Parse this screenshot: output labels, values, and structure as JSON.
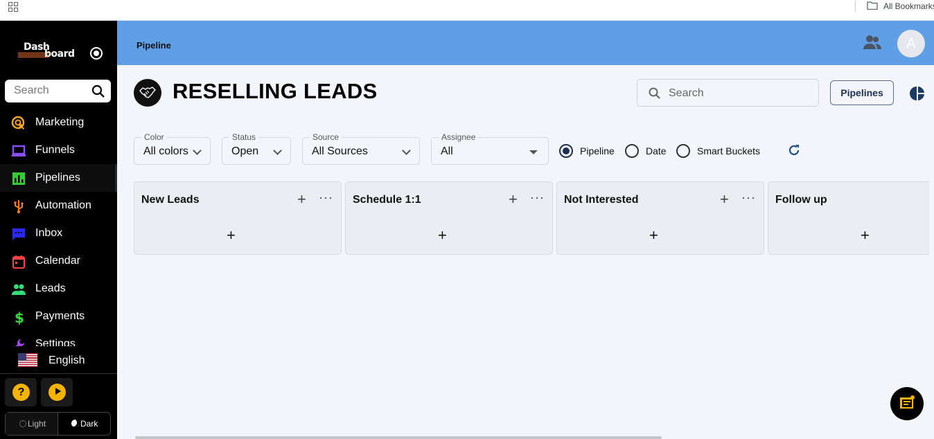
{
  "browser": {
    "bookmarks_label": "All Bookmarks"
  },
  "sidebar": {
    "logo_top": "Dash",
    "logo_bottom": "board",
    "search_placeholder": "Search",
    "items": [
      {
        "label": "Marketing",
        "icon": "cursor-click-icon",
        "color": "#f5a623"
      },
      {
        "label": "Funnels",
        "icon": "laptop-icon",
        "color": "#8a4dff"
      },
      {
        "label": "Pipelines",
        "icon": "bar-chart-icon",
        "color": "#33cc33",
        "active": true
      },
      {
        "label": "Automation",
        "icon": "usb-icon",
        "color": "#ff7a1a"
      },
      {
        "label": "Inbox",
        "icon": "chat-bubble-icon",
        "color": "#2a2aff"
      },
      {
        "label": "Calendar",
        "icon": "calendar-icon",
        "color": "#ff4040"
      },
      {
        "label": "Leads",
        "icon": "people-icon",
        "color": "#33dd77"
      },
      {
        "label": "Payments",
        "icon": "dollar-icon",
        "color": "#33dd33"
      },
      {
        "label": "Settings",
        "icon": "wrench-icon",
        "color": "#aa44ff"
      }
    ],
    "language": "English",
    "theme": {
      "light": "Light",
      "dark": "Dark"
    }
  },
  "topbar": {
    "title": "Pipeline",
    "avatar_initial": "A",
    "color": "#5f9fe6"
  },
  "main": {
    "title": "RESELLING LEADS",
    "search_placeholder": "Search",
    "pipelines_button": "Pipelines",
    "filters": {
      "color": {
        "label": "Color",
        "value": "All colors"
      },
      "status": {
        "label": "Status",
        "value": "Open"
      },
      "source": {
        "label": "Source",
        "value": "All Sources"
      },
      "assignee": {
        "label": "Assignee",
        "value": "All"
      }
    },
    "view_options": [
      {
        "label": "Pipeline",
        "checked": true
      },
      {
        "label": "Date",
        "checked": false
      },
      {
        "label": "Smart Buckets",
        "checked": false
      }
    ],
    "stages": [
      {
        "title": "New Leads"
      },
      {
        "title": "Schedule 1:1"
      },
      {
        "title": "Not Interested"
      },
      {
        "title": "Follow up"
      }
    ]
  }
}
